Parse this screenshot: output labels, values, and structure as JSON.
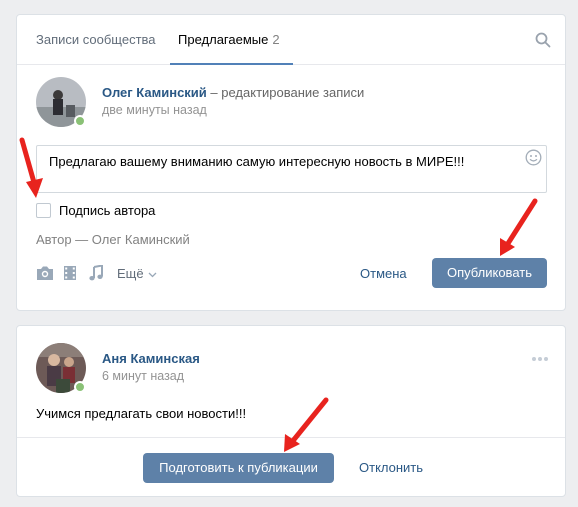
{
  "tabs": {
    "records_label": "Записи сообщества",
    "suggested_label": "Предлагаемые",
    "suggested_count": "2"
  },
  "editor": {
    "author_name": "Олег Каминский",
    "author_action": " – редактирование записи",
    "time": "две минуты назад",
    "text": "Предлагаю вашему вниманию самую интересную новость в МИРЕ!!!",
    "signature_label": "Подпись автора",
    "signature_checked": false,
    "author_line": "Автор — Олег Каминский",
    "attachments": [
      "camera-icon",
      "video-icon",
      "music-icon"
    ],
    "more_label": "Ещё",
    "cancel_label": "Отмена",
    "publish_label": "Опубликовать"
  },
  "post": {
    "author_name": "Аня Каминская",
    "time": "6 минут назад",
    "text": "Учимся предлагать свои новости!!!",
    "prepare_label": "Подготовить к публикации",
    "decline_label": "Отклонить"
  },
  "colors": {
    "accent": "#5181b8",
    "button": "#5e81a8",
    "link": "#2a5885",
    "online": "#8ac176",
    "annotation": "#e8231e"
  }
}
